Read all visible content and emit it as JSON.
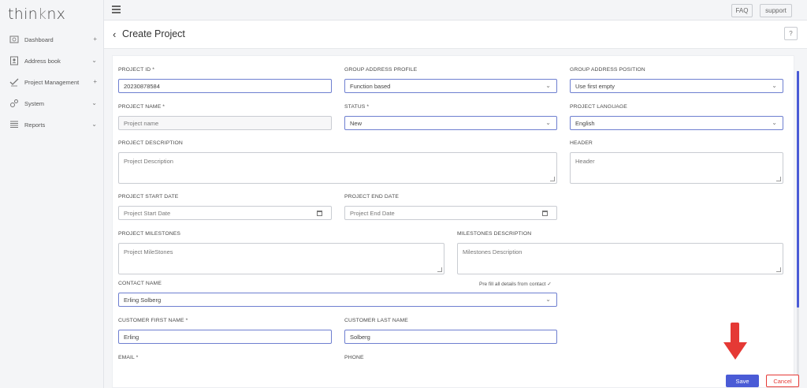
{
  "app": {
    "logo_main": "thin",
    "logo_k": "k",
    "logo_end": "nx"
  },
  "sidebar": {
    "items": [
      {
        "label": "Dashboard",
        "icon": "dashboard-icon",
        "arrow": "+"
      },
      {
        "label": "Address book",
        "icon": "address-book-icon",
        "arrow": "⌄"
      },
      {
        "label": "Project Management",
        "icon": "project-management-icon",
        "arrow": "+"
      },
      {
        "label": "System",
        "icon": "system-icon",
        "arrow": "⌄"
      },
      {
        "label": "Reports",
        "icon": "reports-icon",
        "arrow": "⌄"
      }
    ]
  },
  "topbar": {
    "faq": "FAQ",
    "support": "support"
  },
  "header": {
    "back": "‹",
    "title": "Create Project",
    "help": "?"
  },
  "form": {
    "project_id": {
      "label": "PROJECT ID *",
      "value": "20230878584"
    },
    "group_address_profile": {
      "label": "GROUP ADDRESS PROFILE",
      "value": "Function based"
    },
    "group_address_position": {
      "label": "GROUP ADDRESS POSITION",
      "value": "Use first empty"
    },
    "project_name": {
      "label": "PROJECT NAME *",
      "placeholder": "Project name"
    },
    "status": {
      "label": "STATUS *",
      "value": "New"
    },
    "project_language": {
      "label": "PROJECT LANGUAGE",
      "value": "English"
    },
    "project_description": {
      "label": "PROJECT DESCRIPTION",
      "placeholder": "Project Description"
    },
    "header_field": {
      "label": "HEADER",
      "placeholder": "Header"
    },
    "start_date": {
      "label": "PROJECT START DATE",
      "placeholder": "Project Start Date"
    },
    "end_date": {
      "label": "PROJECT END DATE",
      "placeholder": "Project End Date"
    },
    "milestones": {
      "label": "PROJECT MILESTONES",
      "placeholder": "Project MileStones"
    },
    "milestones_description": {
      "label": "MILESTONES DESCRIPTION",
      "placeholder": "Milestones Description"
    },
    "contact_name": {
      "label": "CONTACT NAME",
      "value": "Erling Solberg",
      "prefill": "Pre fill all details from contact ✓"
    },
    "customer_first_name": {
      "label": "CUSTOMER FIRST NAME *",
      "value": "Erling"
    },
    "customer_last_name": {
      "label": "CUSTOMER LAST NAME",
      "value": "Solberg"
    },
    "email": {
      "label": "EMAIL *"
    },
    "phone": {
      "label": "PHONE"
    }
  },
  "actions": {
    "save": "Save",
    "cancel": "Cancel"
  },
  "colors": {
    "accent": "#4a5bd6",
    "cancel": "#e53935",
    "arrow": "#e53935"
  }
}
